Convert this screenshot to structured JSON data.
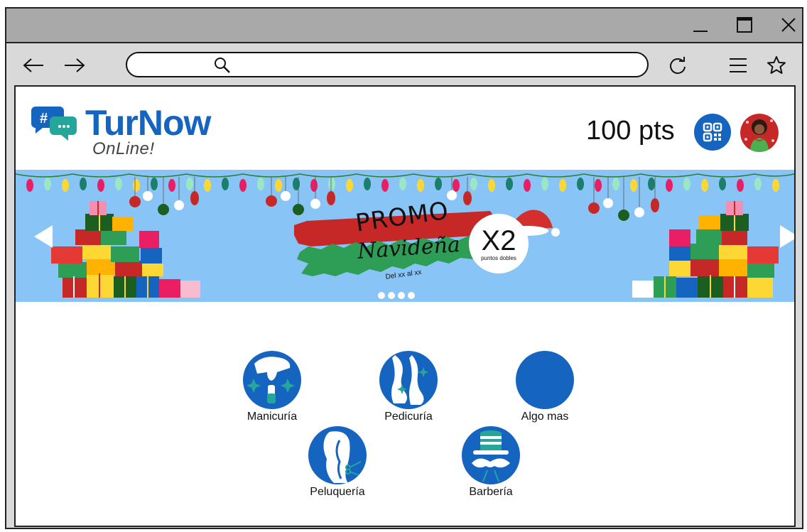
{
  "browser": {
    "window_controls": {
      "minimize_icon": "minimize-icon",
      "maximize_icon": "maximize-icon",
      "close_icon": "close-icon"
    },
    "navigation": {
      "back_icon": "arrow-left-icon",
      "forward_icon": "arrow-right-icon",
      "reload_icon": "reload-icon",
      "menu_icon": "hamburger-menu-icon",
      "bookmark_icon": "star-icon"
    },
    "address_bar": {
      "value": "",
      "placeholder": "",
      "icon": "search-icon"
    }
  },
  "app": {
    "logo": {
      "name": "TurNow",
      "tagline": "OnLine!",
      "icon": "chat-bubbles-icon"
    },
    "header": {
      "points": "100 pts",
      "qr_icon": "qr-code-icon",
      "avatar_icon": "user-avatar"
    },
    "banner": {
      "title": "PROMO",
      "subtitle": "Navideña",
      "dates": "Del xx al xx",
      "badge_value": "X2",
      "badge_label": "puntos dobles",
      "prev_icon": "chevron-left-icon",
      "next_icon": "chevron-right-icon",
      "slide_count": 4
    },
    "services": [
      {
        "label": "Manicuría",
        "icon": "manicure-icon"
      },
      {
        "label": "Pedicuría",
        "icon": "pedicure-icon"
      },
      {
        "label": "Algo mas",
        "icon": "blank-service-icon"
      },
      {
        "label": "Peluquería",
        "icon": "hair-icon"
      },
      {
        "label": "Barbería",
        "icon": "barber-icon"
      }
    ]
  },
  "colors": {
    "brand_blue": "#1565c0",
    "banner_sky": "#88c4f6",
    "promo_red": "#c62828",
    "promo_green": "#2e9e57",
    "titlebar": "#a9a9a9",
    "toolbar": "#d9d9d9"
  }
}
